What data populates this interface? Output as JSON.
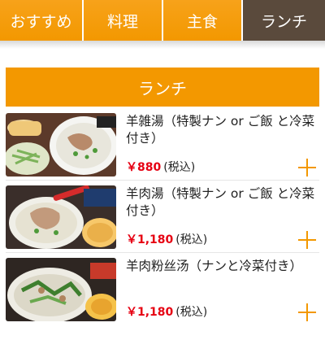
{
  "tabs": [
    {
      "label": "おすすめ"
    },
    {
      "label": "料理"
    },
    {
      "label": "主食"
    },
    {
      "label": "ランチ"
    }
  ],
  "section": {
    "title": "ランチ"
  },
  "items": [
    {
      "name": "羊雑湯（特製ナン or ご飯 と冷菜付き）",
      "price": "￥880",
      "tax": "(税込)"
    },
    {
      "name": "羊肉湯（特製ナン or ご飯 と冷菜付き）",
      "price": "￥1,180",
      "tax": "(税込)"
    },
    {
      "name": "羊肉粉丝汤（ナンと冷菜付き）",
      "price": "￥1,180",
      "tax": "(税込)"
    }
  ],
  "colors": {
    "accent": "#f39800",
    "active_tab": "#5a4a3c",
    "price": "#e60012"
  }
}
